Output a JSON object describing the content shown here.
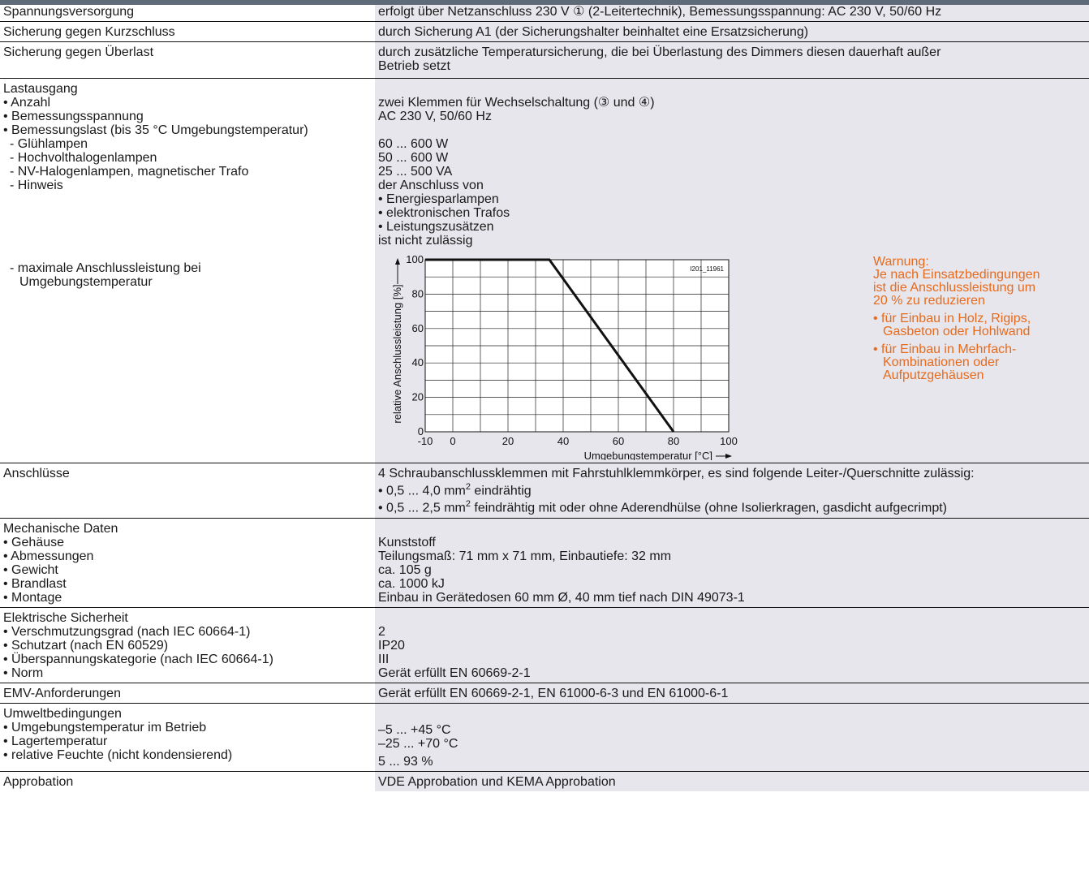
{
  "rows": {
    "r1": {
      "label": "Spannungsversorgung",
      "value": "erfolgt über Netzanschluss 230 V ① (2-Leitertechnik), Bemessungsspannung: AC 230 V, 50/60 Hz"
    },
    "r2": {
      "label": "Sicherung gegen Kurzschluss",
      "value": "durch Sicherung A1 (der Sicherungshalter beinhaltet eine Ersatzsicherung)"
    },
    "r3": {
      "label": "Sicherung gegen Überlast",
      "value1": "durch zusätzliche Temperatursicherung, die bei Überlastung des Dimmers diesen dauerhaft außer",
      "value2": "Betrieb setzt"
    },
    "r4": {
      "title": "Lastausgang",
      "l1": "• Anzahl",
      "v1": "zwei Klemmen für Wechselschaltung (③ und ④)",
      "l2": "• Bemessungsspannung",
      "v2": "AC 230 V, 50/60 Hz",
      "l3": "• Bemessungslast (bis 35 °C Umgebungstemperatur)",
      "l4": "- Glühlampen",
      "v4": "60 ... 600 W",
      "l5": "- Hochvolthalogenlampen",
      "v5": "50 ... 600 W",
      "l6": "- NV-Halogenlampen, magnetischer Trafo",
      "v6": "25 ... 500 VA",
      "l7": "- Hinweis",
      "v7": "der Anschluss von",
      "v8": "• Energiesparlampen",
      "v9": "• elektronischen Trafos",
      "v10": "• Leistungszusätzen",
      "v11": "ist nicht zulässig",
      "l12a": "- maximale Anschlussleistung bei",
      "l12b": "Umgebungstemperatur"
    },
    "r5": {
      "label": "Anschlüsse",
      "v1": "4 Schraubanschlussklemmen mit Fahrstuhlklemmkörper, es sind folgende Leiter-/Querschnitte zulässig:",
      "v2a": "• 0,5 ... 4,0 mm",
      "v2b": "2",
      "v2c": " eindrähtig",
      "v3a": "• 0,5 ... 2,5 mm",
      "v3b": "2",
      "v3c": " feindrähtig mit oder ohne Aderendhülse (ohne Isolierkragen, gasdicht aufgecrimpt)"
    },
    "r6": {
      "title": "Mechanische Daten",
      "l1": "• Gehäuse",
      "v1": "Kunststoff",
      "l2": "• Abmessungen",
      "v2": "Teilungsmaß: 71 mm x 71 mm, Einbautiefe: 32 mm",
      "l3": "• Gewicht",
      "v3": "ca. 105 g",
      "l4": "• Brandlast",
      "v4": "ca. 1000 kJ",
      "l5": "• Montage",
      "v5": "Einbau in Gerätedosen 60 mm Ø, 40 mm tief nach DIN 49073-1"
    },
    "r7": {
      "title": "Elektrische Sicherheit",
      "l1": "• Verschmutzungsgrad (nach IEC 60664-1)",
      "v1": "2",
      "l2": "• Schutzart (nach EN 60529)",
      "v2": "IP20",
      "l3": "• Überspannungskategorie (nach IEC 60664-1)",
      "v3": "III",
      "l4": "• Norm",
      "v4": "Gerät erfüllt EN 60669-2-1"
    },
    "r8": {
      "label": "EMV-Anforderungen",
      "value": "Gerät erfüllt EN 60669-2-1, EN 61000-6-3 und EN 61000-6-1"
    },
    "r9": {
      "title": "Umweltbedingungen",
      "l1": "• Umgebungstemperatur im Betrieb",
      "v1": "–5 ... +45 °C",
      "l2": "• Lagertemperatur",
      "v2": "–25 ... +70 °C",
      "l3": "• relative Feuchte (nicht kondensierend)",
      "v3": "5 ... 93 %"
    },
    "r10": {
      "label": "Approbation",
      "value": "VDE Approbation und KEMA Approbation"
    }
  },
  "warning": {
    "title": "Warnung:",
    "text1": "Je nach Einsatzbedingungen",
    "text2": "ist die Anschlussleistung um",
    "text3": "20 % zu reduzieren",
    "b1a": "• für Einbau in Holz, Rigips,",
    "b1b": "Gasbeton oder Hohlwand",
    "b2a": "• für Einbau in Mehrfach-",
    "b2b": "Kombinationen oder",
    "b2c": "Aufputzgehäusen",
    "color": "#e86a1c"
  },
  "chart_data": {
    "type": "line",
    "id_label": "I201_11961",
    "xlabel": "Umgebungstemperatur [°C]",
    "ylabel": "relative Anschlussleistung [%]",
    "xlim": [
      -10,
      100
    ],
    "ylim": [
      0,
      100
    ],
    "xticks": [
      "-10",
      "0",
      "20",
      "40",
      "60",
      "80",
      "100"
    ],
    "yticks": [
      "0",
      "20",
      "40",
      "60",
      "80",
      "100"
    ],
    "x": [
      -10,
      35,
      80
    ],
    "y": [
      100,
      100,
      0
    ],
    "grid": true
  }
}
